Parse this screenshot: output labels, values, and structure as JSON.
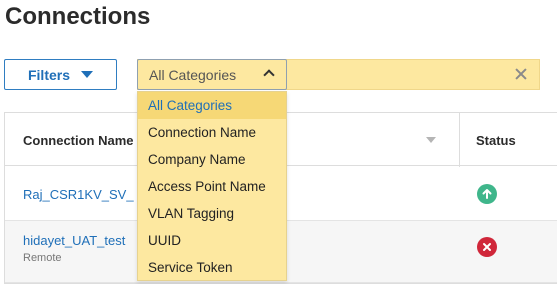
{
  "page": {
    "title": "Connections"
  },
  "toolbar": {
    "filters_label": "Filters",
    "category_select": {
      "value": "All Categories",
      "options": [
        "All Categories",
        "Connection Name",
        "Company Name",
        "Access Point Name",
        "VLAN Tagging",
        "UUID",
        "Service Token"
      ],
      "selected_index": 0
    }
  },
  "table": {
    "columns": [
      "Connection Name",
      "Status"
    ],
    "rows": [
      {
        "name": "Raj_CSR1KV_SV_",
        "subtitle": "",
        "status": "up"
      },
      {
        "name": "hidayet_UAT_test",
        "subtitle": "Remote",
        "status": "error"
      }
    ]
  },
  "colors": {
    "accent": "#1f6fb8",
    "highlight": "#fde8a0",
    "status_up": "#3fb68b",
    "status_error": "#d0273a"
  }
}
